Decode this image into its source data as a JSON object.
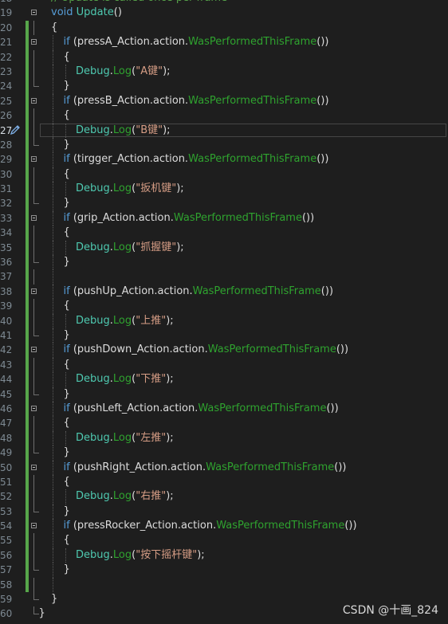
{
  "editor": {
    "current_line": "27",
    "lines": [
      {
        "n": "18",
        "fold": "none",
        "indent": 1,
        "tokens": [
          {
            "t": "comment",
            "v": "// Update is called once per frame"
          }
        ]
      },
      {
        "n": "19",
        "fold": "box",
        "indent": 1,
        "tokens": [
          {
            "t": "kw",
            "v": "void "
          },
          {
            "t": "method",
            "v": "Update"
          },
          {
            "t": "plain",
            "v": "()"
          }
        ]
      },
      {
        "n": "20",
        "fold": "line",
        "indent": 1,
        "tokens": [
          {
            "t": "plain",
            "v": "{"
          }
        ]
      },
      {
        "n": "21",
        "fold": "box",
        "indent": 2,
        "tokens": [
          {
            "t": "ctrl",
            "v": "if "
          },
          {
            "t": "plain",
            "v": "(pressA_Action.action."
          },
          {
            "t": "wpf",
            "v": "WasPerformedThisFrame"
          },
          {
            "t": "plain",
            "v": "())"
          }
        ]
      },
      {
        "n": "22",
        "fold": "line",
        "indent": 2,
        "tokens": [
          {
            "t": "plain",
            "v": "{"
          }
        ]
      },
      {
        "n": "23",
        "fold": "line",
        "indent": 3,
        "tokens": [
          {
            "t": "log",
            "v": "Debug"
          },
          {
            "t": "plain",
            "v": "."
          },
          {
            "t": "wpf",
            "v": "Log"
          },
          {
            "t": "plain",
            "v": "("
          },
          {
            "t": "str",
            "v": "\"A键\""
          },
          {
            "t": "plain",
            "v": ");"
          }
        ]
      },
      {
        "n": "24",
        "fold": "end",
        "indent": 2,
        "tokens": [
          {
            "t": "plain",
            "v": "}"
          }
        ]
      },
      {
        "n": "25",
        "fold": "box",
        "indent": 2,
        "tokens": [
          {
            "t": "ctrl",
            "v": "if "
          },
          {
            "t": "plain",
            "v": "(pressB_Action.action."
          },
          {
            "t": "wpf",
            "v": "WasPerformedThisFrame"
          },
          {
            "t": "plain",
            "v": "())"
          }
        ]
      },
      {
        "n": "26",
        "fold": "line",
        "indent": 2,
        "tokens": [
          {
            "t": "plain",
            "v": "{"
          }
        ]
      },
      {
        "n": "27",
        "fold": "line",
        "indent": 3,
        "tokens": [
          {
            "t": "log",
            "v": "Debug"
          },
          {
            "t": "plain",
            "v": "."
          },
          {
            "t": "wpf",
            "v": "Log"
          },
          {
            "t": "plain",
            "v": "("
          },
          {
            "t": "str",
            "v": "\"B键\""
          },
          {
            "t": "plain",
            "v": ");"
          }
        ]
      },
      {
        "n": "28",
        "fold": "end",
        "indent": 2,
        "tokens": [
          {
            "t": "plain",
            "v": "}"
          }
        ]
      },
      {
        "n": "29",
        "fold": "box",
        "indent": 2,
        "tokens": [
          {
            "t": "ctrl",
            "v": "if "
          },
          {
            "t": "plain",
            "v": "(tirgger_Action.action."
          },
          {
            "t": "wpf",
            "v": "WasPerformedThisFrame"
          },
          {
            "t": "plain",
            "v": "())"
          }
        ]
      },
      {
        "n": "30",
        "fold": "line",
        "indent": 2,
        "tokens": [
          {
            "t": "plain",
            "v": "{"
          }
        ]
      },
      {
        "n": "31",
        "fold": "line",
        "indent": 3,
        "tokens": [
          {
            "t": "log",
            "v": "Debug"
          },
          {
            "t": "plain",
            "v": "."
          },
          {
            "t": "wpf",
            "v": "Log"
          },
          {
            "t": "plain",
            "v": "("
          },
          {
            "t": "str",
            "v": "\"扳机键\""
          },
          {
            "t": "plain",
            "v": ");"
          }
        ]
      },
      {
        "n": "32",
        "fold": "end",
        "indent": 2,
        "tokens": [
          {
            "t": "plain",
            "v": "}"
          }
        ]
      },
      {
        "n": "33",
        "fold": "box",
        "indent": 2,
        "tokens": [
          {
            "t": "ctrl",
            "v": "if "
          },
          {
            "t": "plain",
            "v": "(grip_Action.action."
          },
          {
            "t": "wpf",
            "v": "WasPerformedThisFrame"
          },
          {
            "t": "plain",
            "v": "())"
          }
        ]
      },
      {
        "n": "34",
        "fold": "line",
        "indent": 2,
        "tokens": [
          {
            "t": "plain",
            "v": "{"
          }
        ]
      },
      {
        "n": "35",
        "fold": "line",
        "indent": 3,
        "tokens": [
          {
            "t": "log",
            "v": "Debug"
          },
          {
            "t": "plain",
            "v": "."
          },
          {
            "t": "wpf",
            "v": "Log"
          },
          {
            "t": "plain",
            "v": "("
          },
          {
            "t": "str",
            "v": "\"抓握键\""
          },
          {
            "t": "plain",
            "v": ");"
          }
        ]
      },
      {
        "n": "36",
        "fold": "end",
        "indent": 2,
        "tokens": [
          {
            "t": "plain",
            "v": "}"
          }
        ]
      },
      {
        "n": "37",
        "fold": "line",
        "indent": 2,
        "tokens": []
      },
      {
        "n": "38",
        "fold": "box",
        "indent": 2,
        "tokens": [
          {
            "t": "ctrl",
            "v": "if "
          },
          {
            "t": "plain",
            "v": "(pushUp_Action.action."
          },
          {
            "t": "wpf",
            "v": "WasPerformedThisFrame"
          },
          {
            "t": "plain",
            "v": "())"
          }
        ]
      },
      {
        "n": "39",
        "fold": "line",
        "indent": 2,
        "tokens": [
          {
            "t": "plain",
            "v": "{"
          }
        ]
      },
      {
        "n": "40",
        "fold": "line",
        "indent": 3,
        "tokens": [
          {
            "t": "log",
            "v": "Debug"
          },
          {
            "t": "plain",
            "v": "."
          },
          {
            "t": "wpf",
            "v": "Log"
          },
          {
            "t": "plain",
            "v": "("
          },
          {
            "t": "str",
            "v": "\"上推\""
          },
          {
            "t": "plain",
            "v": ");"
          }
        ]
      },
      {
        "n": "41",
        "fold": "end",
        "indent": 2,
        "tokens": [
          {
            "t": "plain",
            "v": "}"
          }
        ]
      },
      {
        "n": "42",
        "fold": "box",
        "indent": 2,
        "tokens": [
          {
            "t": "ctrl",
            "v": "if "
          },
          {
            "t": "plain",
            "v": "(pushDown_Action.action."
          },
          {
            "t": "wpf",
            "v": "WasPerformedThisFrame"
          },
          {
            "t": "plain",
            "v": "())"
          }
        ]
      },
      {
        "n": "43",
        "fold": "line",
        "indent": 2,
        "tokens": [
          {
            "t": "plain",
            "v": "{"
          }
        ]
      },
      {
        "n": "44",
        "fold": "line",
        "indent": 3,
        "tokens": [
          {
            "t": "log",
            "v": "Debug"
          },
          {
            "t": "plain",
            "v": "."
          },
          {
            "t": "wpf",
            "v": "Log"
          },
          {
            "t": "plain",
            "v": "("
          },
          {
            "t": "str",
            "v": "\"下推\""
          },
          {
            "t": "plain",
            "v": ");"
          }
        ]
      },
      {
        "n": "45",
        "fold": "end",
        "indent": 2,
        "tokens": [
          {
            "t": "plain",
            "v": "}"
          }
        ]
      },
      {
        "n": "46",
        "fold": "box",
        "indent": 2,
        "tokens": [
          {
            "t": "ctrl",
            "v": "if "
          },
          {
            "t": "plain",
            "v": "(pushLeft_Action.action."
          },
          {
            "t": "wpf",
            "v": "WasPerformedThisFrame"
          },
          {
            "t": "plain",
            "v": "())"
          }
        ]
      },
      {
        "n": "47",
        "fold": "line",
        "indent": 2,
        "tokens": [
          {
            "t": "plain",
            "v": "{"
          }
        ]
      },
      {
        "n": "48",
        "fold": "line",
        "indent": 3,
        "tokens": [
          {
            "t": "log",
            "v": "Debug"
          },
          {
            "t": "plain",
            "v": "."
          },
          {
            "t": "wpf",
            "v": "Log"
          },
          {
            "t": "plain",
            "v": "("
          },
          {
            "t": "str",
            "v": "\"左推\""
          },
          {
            "t": "plain",
            "v": ");"
          }
        ]
      },
      {
        "n": "49",
        "fold": "end",
        "indent": 2,
        "tokens": [
          {
            "t": "plain",
            "v": "}"
          }
        ]
      },
      {
        "n": "50",
        "fold": "box",
        "indent": 2,
        "tokens": [
          {
            "t": "ctrl",
            "v": "if "
          },
          {
            "t": "plain",
            "v": "(pushRight_Action.action."
          },
          {
            "t": "wpf",
            "v": "WasPerformedThisFrame"
          },
          {
            "t": "plain",
            "v": "())"
          }
        ]
      },
      {
        "n": "51",
        "fold": "line",
        "indent": 2,
        "tokens": [
          {
            "t": "plain",
            "v": "{"
          }
        ]
      },
      {
        "n": "52",
        "fold": "line",
        "indent": 3,
        "tokens": [
          {
            "t": "log",
            "v": "Debug"
          },
          {
            "t": "plain",
            "v": "."
          },
          {
            "t": "wpf",
            "v": "Log"
          },
          {
            "t": "plain",
            "v": "("
          },
          {
            "t": "str",
            "v": "\"右推\""
          },
          {
            "t": "plain",
            "v": ");"
          }
        ]
      },
      {
        "n": "53",
        "fold": "end",
        "indent": 2,
        "tokens": [
          {
            "t": "plain",
            "v": "}"
          }
        ]
      },
      {
        "n": "54",
        "fold": "box",
        "indent": 2,
        "tokens": [
          {
            "t": "ctrl",
            "v": "if "
          },
          {
            "t": "plain",
            "v": "(pressRocker_Action.action."
          },
          {
            "t": "wpf",
            "v": "WasPerformedThisFrame"
          },
          {
            "t": "plain",
            "v": "())"
          }
        ]
      },
      {
        "n": "55",
        "fold": "line",
        "indent": 2,
        "tokens": [
          {
            "t": "plain",
            "v": "{"
          }
        ]
      },
      {
        "n": "56",
        "fold": "line",
        "indent": 3,
        "tokens": [
          {
            "t": "log",
            "v": "Debug"
          },
          {
            "t": "plain",
            "v": "."
          },
          {
            "t": "wpf",
            "v": "Log"
          },
          {
            "t": "plain",
            "v": "("
          },
          {
            "t": "str",
            "v": "\"按下摇杆键\""
          },
          {
            "t": "plain",
            "v": ");"
          }
        ]
      },
      {
        "n": "57",
        "fold": "end",
        "indent": 2,
        "tokens": [
          {
            "t": "plain",
            "v": "}"
          }
        ]
      },
      {
        "n": "58",
        "fold": "line",
        "indent": 2,
        "tokens": []
      },
      {
        "n": "59",
        "fold": "end",
        "indent": 1,
        "tokens": [
          {
            "t": "plain",
            "v": "}"
          }
        ]
      },
      {
        "n": "60",
        "fold": "end",
        "indent": 0,
        "tokens": [
          {
            "t": "plain",
            "v": "}"
          }
        ]
      }
    ]
  },
  "colors": {
    "background": "#1e1e1e",
    "change_bar": "#57a64a",
    "method_green": "#2fa32f",
    "string": "#d69d85",
    "keyword": "#569cd6",
    "type": "#4ec9b0"
  },
  "watermark": "CSDN @十画_824",
  "icons": {
    "current_line_marker": "pencil-icon"
  }
}
